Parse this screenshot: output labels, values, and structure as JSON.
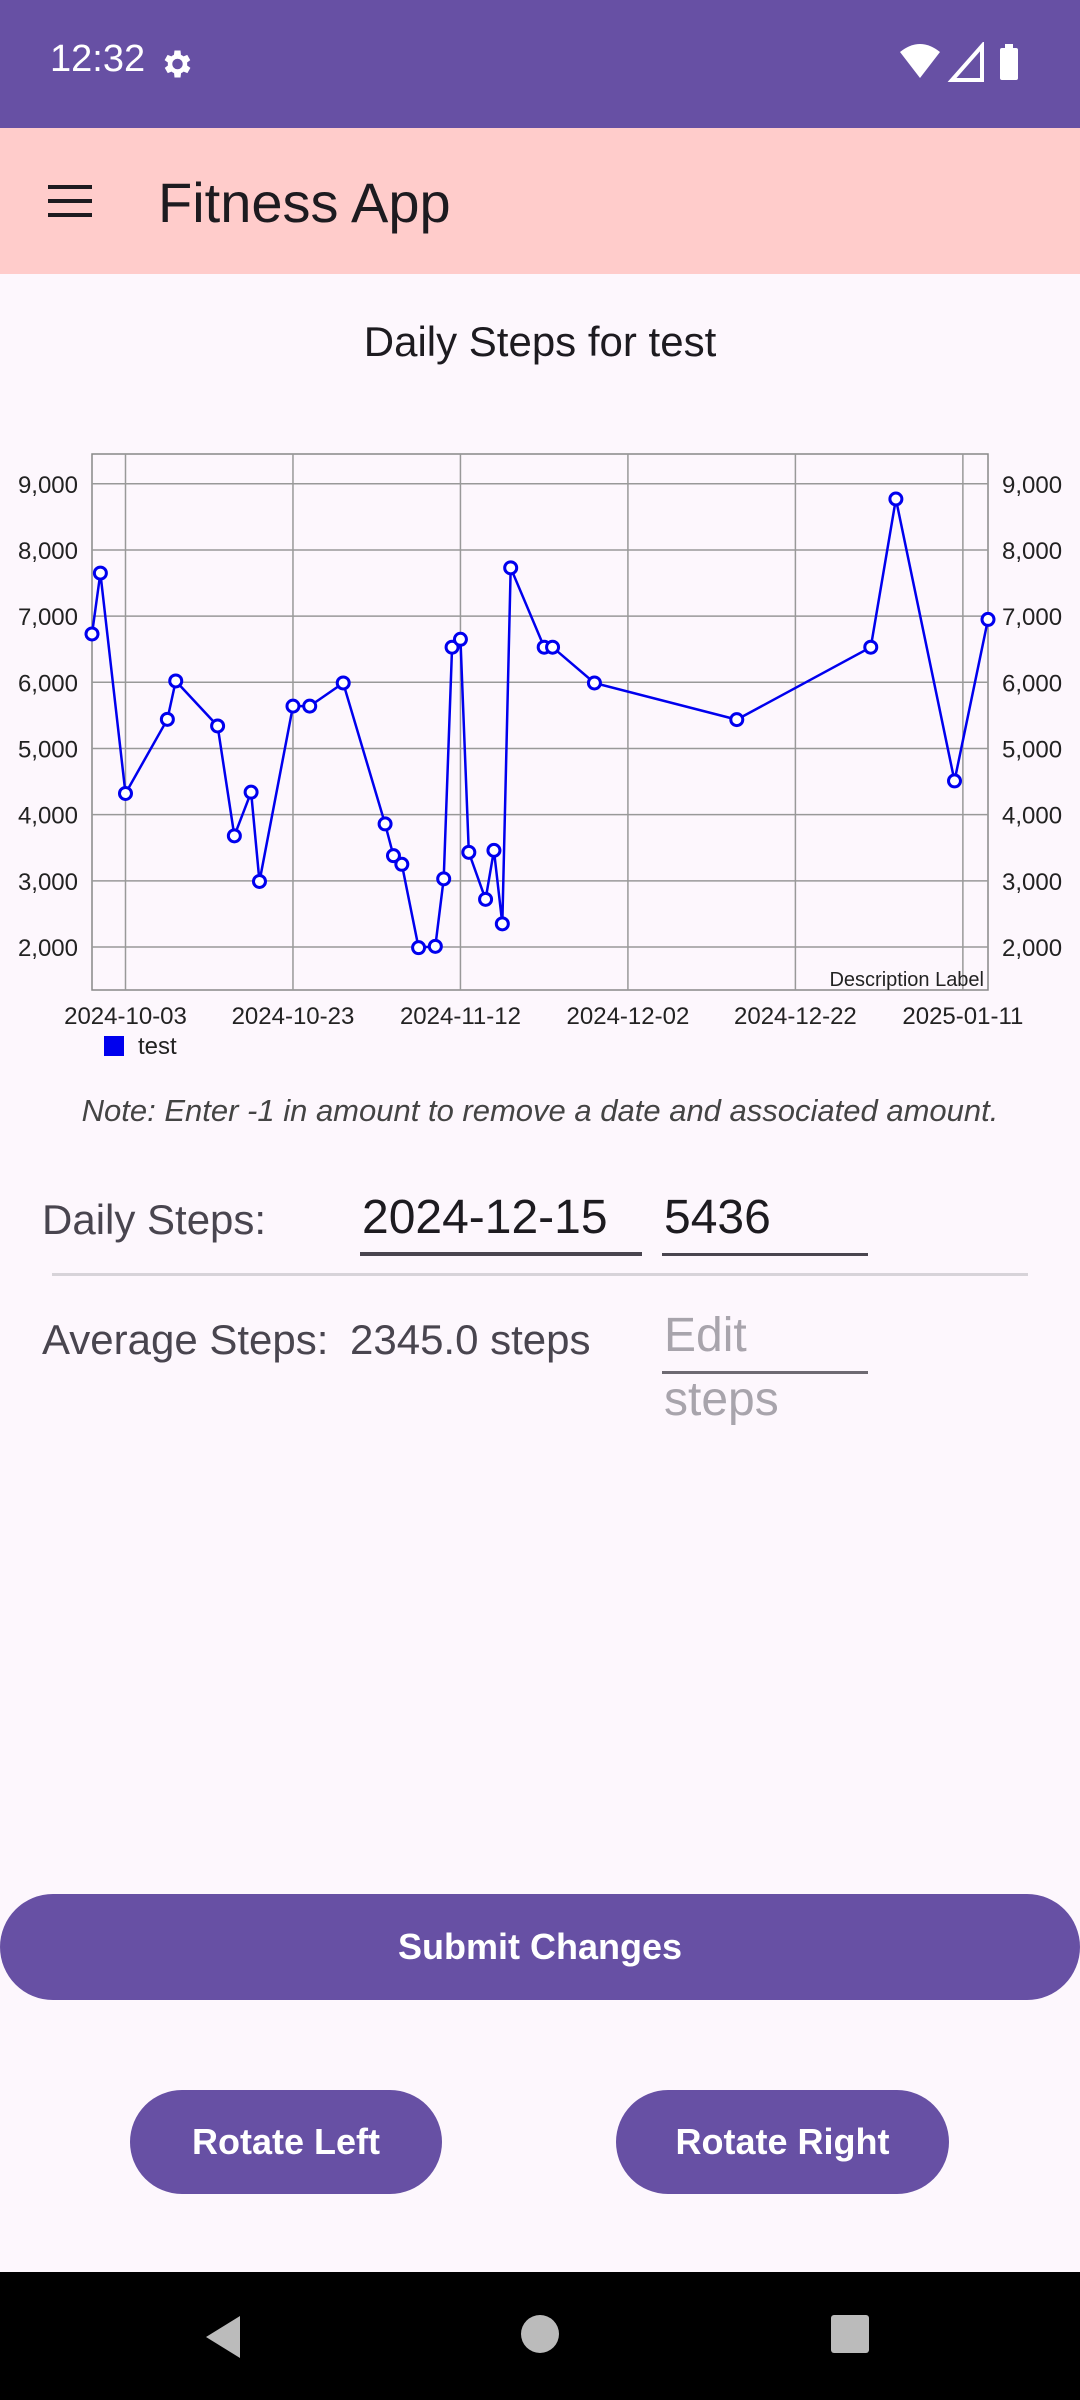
{
  "status_bar": {
    "time": "12:32"
  },
  "app_bar": {
    "title": "Fitness App"
  },
  "chart_title": "Daily Steps for test",
  "chart_data": {
    "type": "line",
    "description": "Description Label",
    "legend": [
      "test"
    ],
    "legend_position": "bottom-left",
    "grid": true,
    "series_color": "#0000ee",
    "x_tick_labels": [
      "2024-10-03",
      "2024-10-23",
      "2024-11-12",
      "2024-12-02",
      "2024-12-22",
      "2025-01-11"
    ],
    "y_tick_labels": [
      "2,000",
      "3,000",
      "4,000",
      "5,000",
      "6,000",
      "7,000",
      "8,000",
      "9,000"
    ],
    "ylim": [
      1350,
      9450
    ],
    "series": [
      {
        "name": "test",
        "x": [
          "2024-09-29",
          "2024-09-30",
          "2024-10-03",
          "2024-10-08",
          "2024-10-09",
          "2024-10-14",
          "2024-10-16",
          "2024-10-18",
          "2024-10-19",
          "2024-10-23",
          "2024-10-25",
          "2024-10-29",
          "2024-11-03",
          "2024-11-04",
          "2024-11-05",
          "2024-11-07",
          "2024-11-09",
          "2024-11-10",
          "2024-11-11",
          "2024-11-12",
          "2024-11-13",
          "2024-11-15",
          "2024-11-16",
          "2024-11-17",
          "2024-11-18",
          "2024-11-22",
          "2024-11-23",
          "2024-11-28",
          "2024-12-15",
          "2024-12-31",
          "2025-01-03",
          "2025-01-10",
          "2025-01-14"
        ],
        "y": [
          6730,
          7650,
          4320,
          5440,
          6020,
          5340,
          3680,
          4340,
          2990,
          5640,
          5640,
          5990,
          3860,
          3380,
          3250,
          1990,
          2010,
          3030,
          6530,
          6650,
          3430,
          2720,
          3460,
          2350,
          7730,
          6530,
          6530,
          5990,
          5436,
          6530,
          8770,
          4510,
          6950
        ]
      }
    ]
  },
  "note": "Note: Enter -1 in amount to remove a date and associated amount.",
  "daily_steps": {
    "label": "Daily Steps:",
    "date_value": "2024-12-15",
    "amount_value": "5436"
  },
  "average_steps": {
    "label": "Average Steps:",
    "value": "2345.0 steps",
    "edit_placeholder": "Edit steps"
  },
  "buttons": {
    "submit": "Submit Changes",
    "rotate_left": "Rotate Left",
    "rotate_right": "Rotate Right"
  }
}
